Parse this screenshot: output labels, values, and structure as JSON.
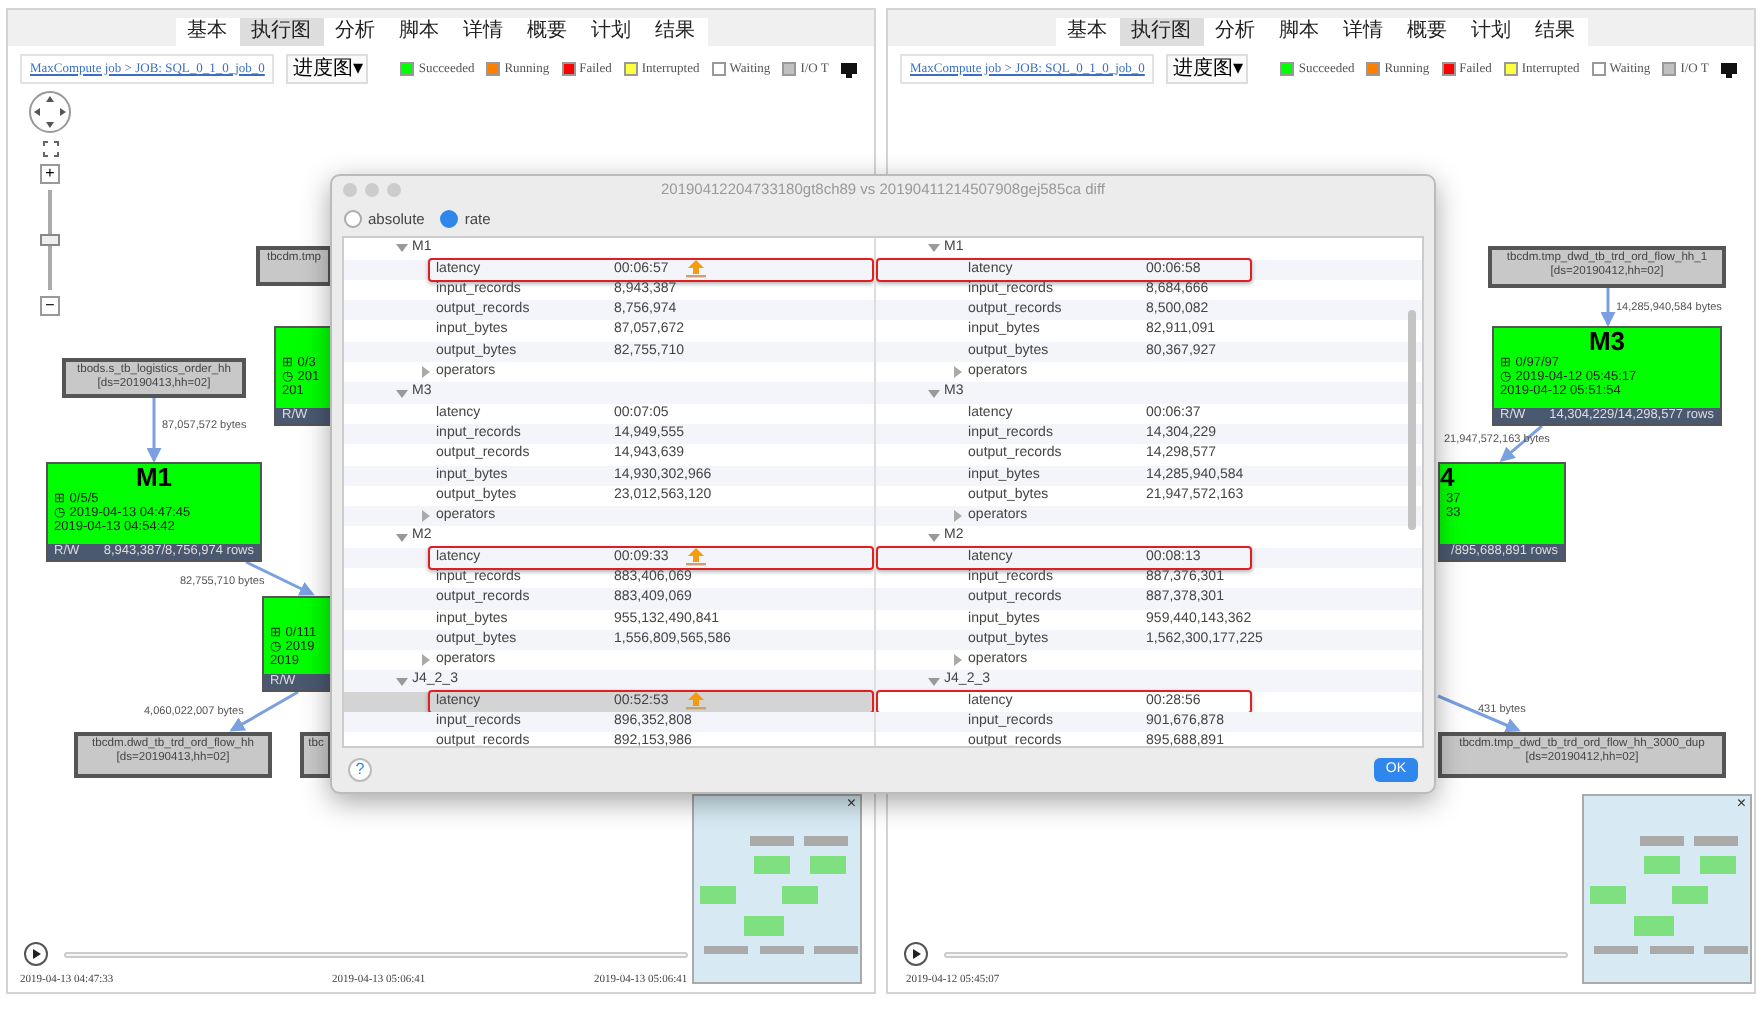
{
  "panels": [
    {
      "tabs": [
        {
          "label": "基本",
          "selected": false
        },
        {
          "label": "执行图",
          "selected": true
        },
        {
          "label": "分析",
          "selected": false
        },
        {
          "label": "脚本",
          "selected": false
        },
        {
          "label": "详情",
          "selected": false
        },
        {
          "label": "概要",
          "selected": false
        },
        {
          "label": "计划",
          "selected": false
        },
        {
          "label": "结果",
          "selected": false
        }
      ],
      "breadcrumb": "MaxCompute job > JOB: SQL_0_1_0_job_0",
      "view_menu": "进度图▾",
      "legend": [
        {
          "label": "Succeeded",
          "color": "#00ff00"
        },
        {
          "label": "Running",
          "color": "#ff8000"
        },
        {
          "label": "Failed",
          "color": "#ff0000"
        },
        {
          "label": "Interrupted",
          "color": "#ffff40"
        },
        {
          "label": "Waiting",
          "color": "#ffffff"
        },
        {
          "label": "I/O T",
          "color": "#c0c0c0"
        }
      ],
      "zoom": {
        "level": 0.5,
        "in": "+",
        "out": "−"
      },
      "nodes": [
        {
          "kind": "table",
          "lines": [
            "tbods.s_tb_logistics_order_hh",
            "[ds=20190413,hh=02]"
          ]
        },
        {
          "kind": "task",
          "title": "M1",
          "lines": [
            "⊞ 0/5/5",
            "◷ 2019-04-13 04:47:45",
            "2019-04-13 04:54:42"
          ],
          "rw": "R/W",
          "rows": "8,943,387/8,756,974 rows"
        },
        {
          "kind": "table",
          "lines": [
            "tbcdm.dwd_tb_trd_ord_flow_hh",
            "[ds=20190413,hh=02]"
          ]
        },
        {
          "kind": "table",
          "lines": [
            "tbcdm.tmp"
          ]
        },
        {
          "kind": "task",
          "lines": [
            "⊞ 0/3",
            "◷ 201",
            "201"
          ],
          "rw": "R/W"
        },
        {
          "kind": "task",
          "lines": [
            "⊞ 0/111",
            "◷ 2019",
            "2019"
          ],
          "rw": "R/W"
        },
        {
          "kind": "table",
          "lines": [
            "tbc"
          ]
        }
      ],
      "edges": [
        {
          "label": "87,057,572 bytes"
        },
        {
          "label": "82,755,710 bytes"
        },
        {
          "label": "4,060,022,007 bytes"
        }
      ],
      "minimap": {
        "close": "×"
      },
      "times": [
        "2019-04-13 04:47:33",
        "2019-04-13 05:06:41",
        "2019-04-13 05:06:41"
      ]
    },
    {
      "tabs": [
        {
          "label": "基本",
          "selected": false
        },
        {
          "label": "执行图",
          "selected": true
        },
        {
          "label": "分析",
          "selected": false
        },
        {
          "label": "脚本",
          "selected": false
        },
        {
          "label": "详情",
          "selected": false
        },
        {
          "label": "概要",
          "selected": false
        },
        {
          "label": "计划",
          "selected": false
        },
        {
          "label": "结果",
          "selected": false
        }
      ],
      "breadcrumb": "MaxCompute job > JOB: SQL_0_1_0_job_0",
      "view_menu": "进度图▾",
      "legend": [
        {
          "label": "Succeeded",
          "color": "#00ff00"
        },
        {
          "label": "Running",
          "color": "#ff8000"
        },
        {
          "label": "Failed",
          "color": "#ff0000"
        },
        {
          "label": "Interrupted",
          "color": "#ffff40"
        },
        {
          "label": "Waiting",
          "color": "#ffffff"
        },
        {
          "label": "I/O T",
          "color": "#c0c0c0"
        }
      ],
      "nodes": [
        {
          "kind": "table",
          "lines": [
            "tbcdm.tmp_dwd_tb_trd_ord_flow_hh_1",
            "[ds=20190412,hh=02]"
          ]
        },
        {
          "kind": "task",
          "title": "M3",
          "lines": [
            "⊞ 0/97/97",
            "◷ 2019-04-12 05:45:17",
            "2019-04-12 05:51:54"
          ],
          "rw": "R/W",
          "rows": "14,304,229/14,298,577 rows"
        },
        {
          "kind": "task",
          "title": "4",
          "lines": [
            "37",
            "33"
          ],
          "rows": "/895,688,891 rows"
        },
        {
          "kind": "table",
          "lines": [
            "tbcdm.tmp_dwd_tb_trd_ord_flow_hh_3000_dup",
            "[ds=20190412,hh=02]"
          ]
        }
      ],
      "edges": [
        {
          "label": "14,285,940,584 bytes"
        },
        {
          "label": "21,947,572,163 bytes"
        },
        {
          "label": "431 bytes"
        }
      ],
      "minimap": {
        "close": "×"
      },
      "times": [
        "2019-04-12 05:45:07"
      ]
    }
  ],
  "dialog": {
    "title": "20190412204733180gt8ch89 vs 20190411214507908gej585ca diff",
    "modes": [
      {
        "label": "absolute",
        "selected": false
      },
      {
        "label": "rate",
        "selected": true
      }
    ],
    "panes": [
      [
        {
          "kind": "group",
          "label": "M1",
          "expanded": true
        },
        {
          "kind": "metric",
          "name": "latency",
          "value": "00:06:57",
          "alert": true,
          "highlighted": true,
          "selected": false
        },
        {
          "kind": "metric",
          "name": "input_records",
          "value": "8,943,387",
          "alert": false,
          "highlighted": false,
          "selected": false
        },
        {
          "kind": "metric",
          "name": "output_records",
          "value": "8,756,974",
          "alert": false,
          "highlighted": false,
          "selected": false
        },
        {
          "kind": "metric",
          "name": "input_bytes",
          "value": "87,057,672",
          "alert": false,
          "highlighted": false,
          "selected": false
        },
        {
          "kind": "metric",
          "name": "output_bytes",
          "value": "82,755,710",
          "alert": false,
          "highlighted": false,
          "selected": false
        },
        {
          "kind": "group",
          "label": "operators",
          "expanded": false
        },
        {
          "kind": "group",
          "label": "M3",
          "expanded": true
        },
        {
          "kind": "metric",
          "name": "latency",
          "value": "00:07:05",
          "alert": false,
          "highlighted": false,
          "selected": false
        },
        {
          "kind": "metric",
          "name": "input_records",
          "value": "14,949,555",
          "alert": false,
          "highlighted": false,
          "selected": false
        },
        {
          "kind": "metric",
          "name": "output_records",
          "value": "14,943,639",
          "alert": false,
          "highlighted": false,
          "selected": false
        },
        {
          "kind": "metric",
          "name": "input_bytes",
          "value": "14,930,302,966",
          "alert": false,
          "highlighted": false,
          "selected": false
        },
        {
          "kind": "metric",
          "name": "output_bytes",
          "value": "23,012,563,120",
          "alert": false,
          "highlighted": false,
          "selected": false
        },
        {
          "kind": "group",
          "label": "operators",
          "expanded": false
        },
        {
          "kind": "group",
          "label": "M2",
          "expanded": true
        },
        {
          "kind": "metric",
          "name": "latency",
          "value": "00:09:33",
          "alert": true,
          "highlighted": true,
          "selected": false
        },
        {
          "kind": "metric",
          "name": "input_records",
          "value": "883,406,069",
          "alert": false,
          "highlighted": false,
          "selected": false
        },
        {
          "kind": "metric",
          "name": "output_records",
          "value": "883,409,069",
          "alert": false,
          "highlighted": false,
          "selected": false
        },
        {
          "kind": "metric",
          "name": "input_bytes",
          "value": "955,132,490,841",
          "alert": false,
          "highlighted": false,
          "selected": false
        },
        {
          "kind": "metric",
          "name": "output_bytes",
          "value": "1,556,809,565,586",
          "alert": false,
          "highlighted": false,
          "selected": false
        },
        {
          "kind": "group",
          "label": "operators",
          "expanded": false
        },
        {
          "kind": "group",
          "label": "J4_2_3",
          "expanded": true
        },
        {
          "kind": "metric",
          "name": "latency",
          "value": "00:52:53",
          "alert": true,
          "highlighted": true,
          "selected": true
        },
        {
          "kind": "metric",
          "name": "input_records",
          "value": "896,352,808",
          "alert": false,
          "highlighted": false,
          "selected": false
        },
        {
          "kind": "metric",
          "name": "output_records",
          "value": "892,153,986",
          "alert": false,
          "highlighted": false,
          "selected": false
        }
      ],
      [
        {
          "kind": "group",
          "label": "M1",
          "expanded": true
        },
        {
          "kind": "metric",
          "name": "latency",
          "value": "00:06:58",
          "alert": false,
          "highlighted": true,
          "selected": false
        },
        {
          "kind": "metric",
          "name": "input_records",
          "value": "8,684,666",
          "alert": false,
          "highlighted": false,
          "selected": false
        },
        {
          "kind": "metric",
          "name": "output_records",
          "value": "8,500,082",
          "alert": false,
          "highlighted": false,
          "selected": false
        },
        {
          "kind": "metric",
          "name": "input_bytes",
          "value": "82,911,091",
          "alert": false,
          "highlighted": false,
          "selected": false
        },
        {
          "kind": "metric",
          "name": "output_bytes",
          "value": "80,367,927",
          "alert": false,
          "highlighted": false,
          "selected": false
        },
        {
          "kind": "group",
          "label": "operators",
          "expanded": false
        },
        {
          "kind": "group",
          "label": "M3",
          "expanded": true
        },
        {
          "kind": "metric",
          "name": "latency",
          "value": "00:06:37",
          "alert": false,
          "highlighted": false,
          "selected": false
        },
        {
          "kind": "metric",
          "name": "input_records",
          "value": "14,304,229",
          "alert": false,
          "highlighted": false,
          "selected": false
        },
        {
          "kind": "metric",
          "name": "output_records",
          "value": "14,298,577",
          "alert": false,
          "highlighted": false,
          "selected": false
        },
        {
          "kind": "metric",
          "name": "input_bytes",
          "value": "14,285,940,584",
          "alert": false,
          "highlighted": false,
          "selected": false
        },
        {
          "kind": "metric",
          "name": "output_bytes",
          "value": "21,947,572,163",
          "alert": false,
          "highlighted": false,
          "selected": false
        },
        {
          "kind": "group",
          "label": "operators",
          "expanded": false
        },
        {
          "kind": "group",
          "label": "M2",
          "expanded": true
        },
        {
          "kind": "metric",
          "name": "latency",
          "value": "00:08:13",
          "alert": false,
          "highlighted": true,
          "selected": false
        },
        {
          "kind": "metric",
          "name": "input_records",
          "value": "887,376,301",
          "alert": false,
          "highlighted": false,
          "selected": false
        },
        {
          "kind": "metric",
          "name": "output_records",
          "value": "887,378,301",
          "alert": false,
          "highlighted": false,
          "selected": false
        },
        {
          "kind": "metric",
          "name": "input_bytes",
          "value": "959,440,143,362",
          "alert": false,
          "highlighted": false,
          "selected": false
        },
        {
          "kind": "metric",
          "name": "output_bytes",
          "value": "1,562,300,177,225",
          "alert": false,
          "highlighted": false,
          "selected": false
        },
        {
          "kind": "group",
          "label": "operators",
          "expanded": false
        },
        {
          "kind": "group",
          "label": "J4_2_3",
          "expanded": true
        },
        {
          "kind": "metric",
          "name": "latency",
          "value": "00:28:56",
          "alert": false,
          "highlighted": true,
          "selected": false
        },
        {
          "kind": "metric",
          "name": "input_records",
          "value": "901,676,878",
          "alert": false,
          "highlighted": false,
          "selected": false
        },
        {
          "kind": "metric",
          "name": "output_records",
          "value": "895,688,891",
          "alert": false,
          "highlighted": false,
          "selected": false
        }
      ]
    ],
    "help": "?",
    "ok": "OK"
  }
}
